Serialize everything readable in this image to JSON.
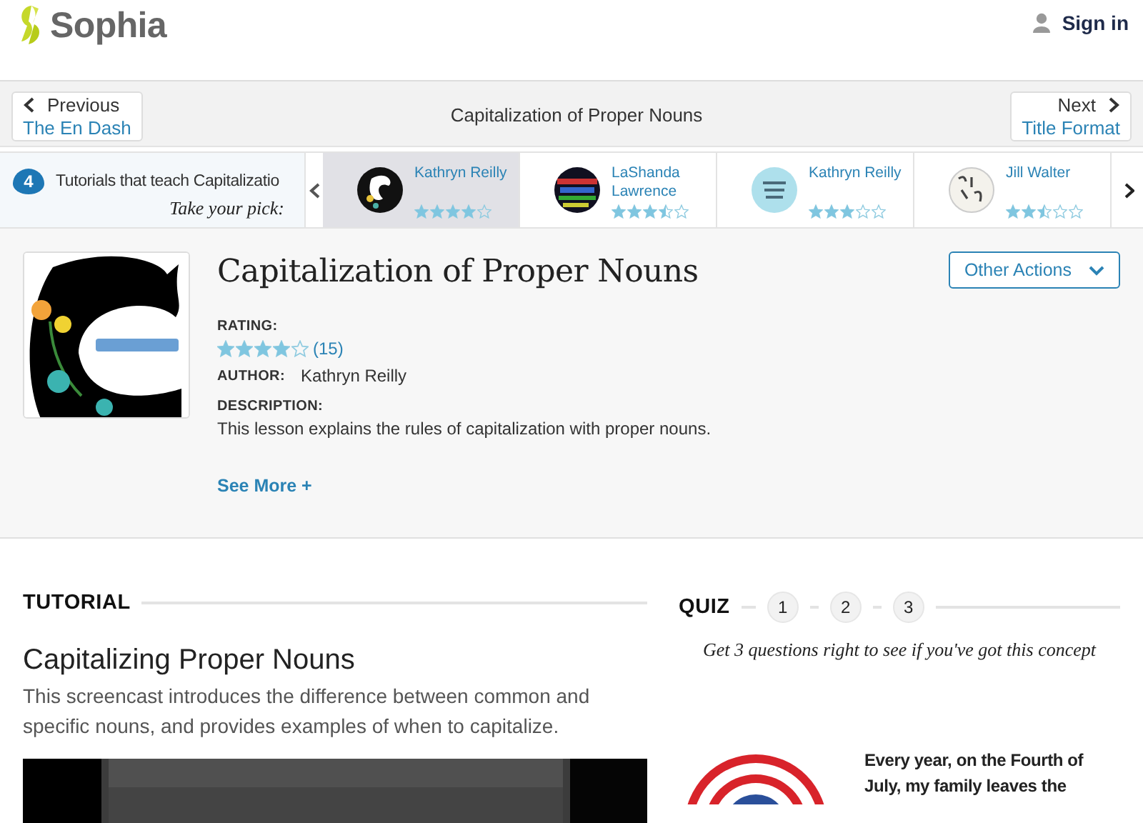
{
  "header": {
    "logo": "Sophia",
    "sign_in": "Sign in"
  },
  "nav": {
    "previous": {
      "label": "Previous",
      "title": "The En Dash"
    },
    "current": "Capitalization of Proper Nouns",
    "next": {
      "label": "Next",
      "title": "Title Format"
    }
  },
  "carousel": {
    "count": "4",
    "heading": "Tutorials that teach Capitalizatio",
    "tagline": "Take your pick:",
    "cards": [
      {
        "author": "Kathryn Reilly",
        "stars": 4,
        "selected": true
      },
      {
        "author": "LaShanda Lawrence",
        "stars": 3.5,
        "selected": false
      },
      {
        "author": "Kathryn Reilly",
        "stars": 3,
        "selected": false
      },
      {
        "author": "Jill Walter",
        "stars": 2.5,
        "selected": false
      }
    ]
  },
  "lesson": {
    "title": "Capitalization of Proper Nouns",
    "actions": "Other Actions",
    "rating_label": "RATING:",
    "stars": 4,
    "rating_count": "(15)",
    "author_label": "AUTHOR:",
    "author": "Kathryn Reilly",
    "description_label": "DESCRIPTION:",
    "description": "This lesson explains the rules of capitalization with proper nouns.",
    "see_more": "See More +"
  },
  "tutorial": {
    "heading": "TUTORIAL",
    "title": "Capitalizing Proper Nouns",
    "description": "This screencast introduces the difference between common and specific nouns, and provides examples of when to capitalize."
  },
  "quiz": {
    "heading": "QUIZ",
    "steps": [
      "1",
      "2",
      "3"
    ],
    "tagline": "Get 3 questions right to see if you've got this concept",
    "story": "Every year, on the Fourth of July, my family leaves the"
  }
}
